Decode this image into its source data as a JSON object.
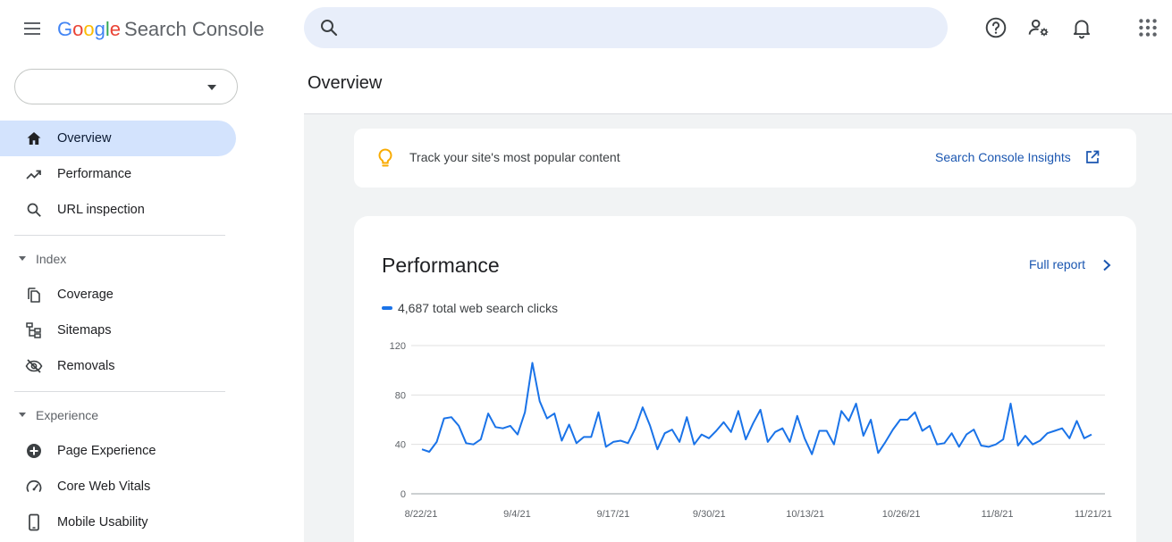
{
  "app": {
    "logo_letters": [
      "G",
      "o",
      "o",
      "g",
      "l",
      "e"
    ],
    "product": "Search Console"
  },
  "search": {
    "placeholder": "",
    "value": ""
  },
  "top_icons": [
    "help-icon",
    "manage-users-icon",
    "notifications-icon",
    "apps-grid-icon"
  ],
  "property_selector": {
    "value": ""
  },
  "sidebar": {
    "items": [
      {
        "label": "Overview",
        "icon": "home-icon",
        "active": true
      },
      {
        "label": "Performance",
        "icon": "trending-up-icon",
        "active": false
      },
      {
        "label": "URL inspection",
        "icon": "search-icon",
        "active": false
      }
    ],
    "sections": [
      {
        "label": "Index",
        "items": [
          {
            "label": "Coverage",
            "icon": "copy-pages-icon"
          },
          {
            "label": "Sitemaps",
            "icon": "sitemap-icon"
          },
          {
            "label": "Removals",
            "icon": "eye-off-icon"
          }
        ]
      },
      {
        "label": "Experience",
        "items": [
          {
            "label": "Page Experience",
            "icon": "plus-circle-icon"
          },
          {
            "label": "Core Web Vitals",
            "icon": "speedometer-icon"
          },
          {
            "label": "Mobile Usability",
            "icon": "phone-icon"
          }
        ]
      }
    ]
  },
  "main": {
    "page_title": "Overview",
    "insight": {
      "text": "Track your site's most popular content",
      "link": "Search Console Insights",
      "icon": "lightbulb-icon"
    },
    "performance": {
      "title": "Performance",
      "full_report": "Full report",
      "legend": "4,687 total web search clicks"
    }
  },
  "colors": {
    "accent": "#1a73e8",
    "link": "#1a56b0",
    "active_nav": "#d3e3fd",
    "search_bg": "#e8eefa",
    "bulb": "#f9ab00"
  },
  "chart_data": {
    "type": "line",
    "series": [
      {
        "name": "Clicks",
        "values": [
          36,
          34,
          42,
          61,
          62,
          55,
          41,
          40,
          44,
          65,
          54,
          53,
          55,
          48,
          66,
          106,
          75,
          61,
          65,
          43,
          56,
          41,
          46,
          46,
          66,
          38,
          42,
          43,
          41,
          53,
          70,
          55,
          36,
          49,
          52,
          42,
          62,
          40,
          48,
          45,
          51,
          58,
          50,
          67,
          44,
          57,
          68,
          42,
          50,
          53,
          42,
          63,
          45,
          32,
          51,
          51,
          40,
          67,
          59,
          73,
          47,
          60,
          33,
          42,
          52,
          60,
          60,
          66,
          51,
          55,
          40,
          41,
          49,
          38,
          48,
          52,
          39,
          38,
          40,
          44,
          73,
          39,
          47,
          40,
          43,
          49,
          51,
          53,
          45,
          59,
          45,
          48
        ]
      }
    ],
    "x_start": "8/22/21",
    "x_end": "11/21/21",
    "x_ticks": [
      "8/22/21",
      "9/4/21",
      "9/17/21",
      "9/30/21",
      "10/13/21",
      "10/26/21",
      "11/8/21",
      "11/21/21"
    ],
    "y_ticks": [
      0,
      40,
      80,
      120
    ],
    "ylim": [
      0,
      120
    ],
    "grid": true,
    "title": "",
    "xlabel": "",
    "ylabel": ""
  }
}
